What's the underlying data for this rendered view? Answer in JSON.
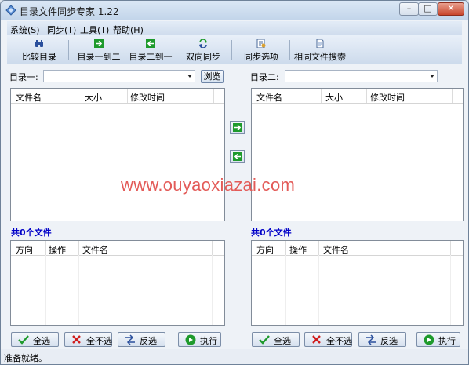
{
  "window": {
    "title": "目录文件同步专家 1.22"
  },
  "menu": [
    "系统(S)",
    "同步(T)",
    "工具(T)",
    "帮助(H)"
  ],
  "toolbar": {
    "compare": "比较目录",
    "one_to_two": "目录一到二",
    "two_to_one": "目录二到一",
    "bidirectional": "双向同步",
    "sync_options": "同步选项",
    "same_search": "相同文件搜索"
  },
  "dir1": {
    "label": "目录一:",
    "value": "",
    "browse": "浏览"
  },
  "dir2": {
    "label": "目录二:",
    "value": ""
  },
  "file_columns": [
    "文件名",
    "大小",
    "修改时间"
  ],
  "count_left": "共0个文件",
  "count_right": "共0个文件",
  "op_columns": [
    "方向",
    "操作",
    "文件名"
  ],
  "watermark": "www.ouyaoxiazai.com",
  "actions": {
    "select_all": "全选",
    "select_none": "全不选",
    "invert": "反选",
    "execute": "执行"
  },
  "status": "准备就绪。",
  "colors": {
    "count": "#0000c8",
    "watermark": "#e35b58",
    "arrow_green": "#1e9a2c"
  }
}
